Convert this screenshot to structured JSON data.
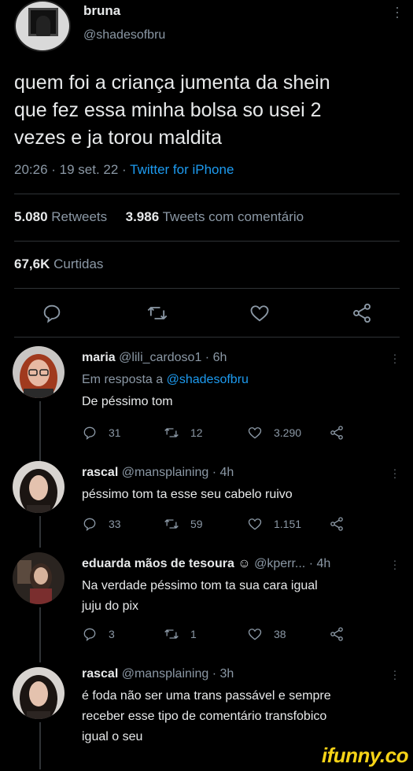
{
  "tweet": {
    "author_name": "bruna",
    "author_handle": "@shadesofbru",
    "text_lines": [
      "quem foi a criança jumenta da shein",
      "que fez essa minha bolsa so usei 2",
      "vezes e ja torou maldita"
    ],
    "time": "20:26 · 19 set. 22 · ",
    "source": "Twitter for iPhone",
    "retweets_count": "5.080",
    "retweets_label": "Retweets",
    "quotes_count": "3.986",
    "quotes_label": "Tweets com comentário",
    "likes_count": "67,6K",
    "likes_label": "Curtidas"
  },
  "replies": [
    {
      "name": "maria",
      "handle": "@lili_cardoso1",
      "time": "· 6h",
      "in_reply_prefix": "Em resposta a ",
      "in_reply_handle": "@shadesofbru",
      "text_lines": [
        "De péssimo tom"
      ],
      "reply_count": "31",
      "retweet_count": "12",
      "like_count": "3.290"
    },
    {
      "name": "rascal",
      "handle": "@mansplaining",
      "time": "· 4h",
      "text_lines": [
        "péssimo tom ta esse seu cabelo ruivo"
      ],
      "reply_count": "33",
      "retweet_count": "59",
      "like_count": "1.151"
    },
    {
      "name": "eduarda mãos de tesoura ☺",
      "handle": "@kperr...",
      "time": "· 4h",
      "text_lines": [
        "Na verdade péssimo tom ta sua cara igual",
        "juju do pix"
      ],
      "reply_count": "3",
      "retweet_count": "1",
      "like_count": "38"
    },
    {
      "name": "rascal",
      "handle": "@mansplaining",
      "time": "· 3h",
      "text_lines": [
        "é foda não ser uma trans passável e sempre",
        "receber esse tipo de comentário transfobico",
        "igual o seu"
      ]
    }
  ],
  "watermark": "ifunny.co",
  "colors": {
    "background": "#000000",
    "text": "#e7e9ea",
    "muted": "#8b98a5",
    "link": "#1d9bf0",
    "divider": "#2f3336",
    "watermark": "#f7d417"
  }
}
